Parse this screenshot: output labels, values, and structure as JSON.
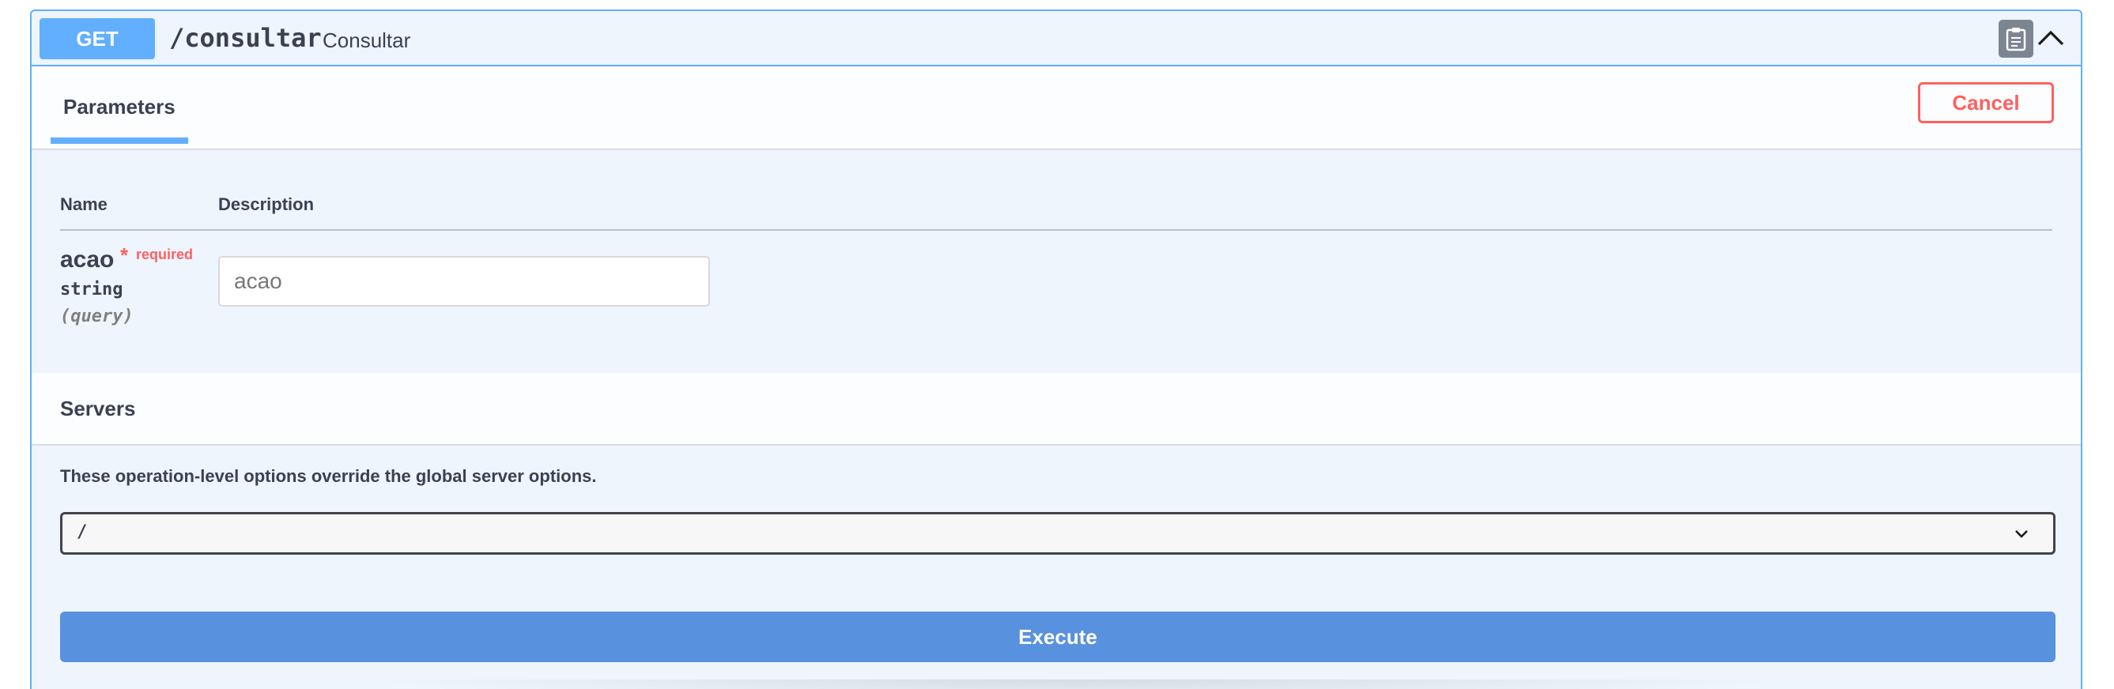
{
  "operation": {
    "method": "GET",
    "path": "/consultar",
    "summary": "Consultar"
  },
  "tabs": {
    "parameters_label": "Parameters",
    "cancel_label": "Cancel"
  },
  "parameters_table": {
    "headers": [
      "Name",
      "Description"
    ],
    "rows": [
      {
        "name": "acao",
        "star": "*",
        "required_label": "required",
        "type": "string",
        "in": "(query)",
        "placeholder": "acao",
        "value": ""
      }
    ]
  },
  "servers": {
    "title": "Servers",
    "note": "These operation-level options override the global server options.",
    "selected": "/"
  },
  "execute_label": "Execute",
  "icons": {
    "copy": "clipboard-icon",
    "collapse": "chevron-up-icon",
    "dropdown": "chevron-down-icon"
  },
  "colors": {
    "get_method": "#61affe",
    "cancel": "#ff6060",
    "execute": "#5891dd"
  }
}
